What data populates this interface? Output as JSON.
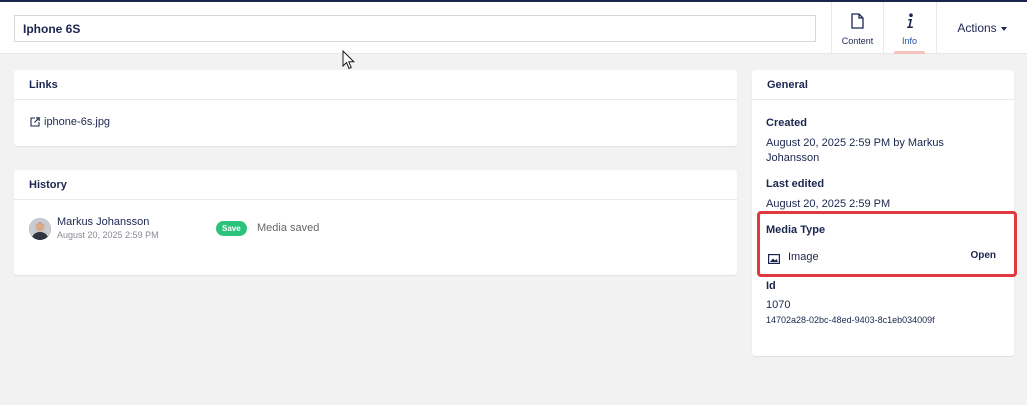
{
  "header": {
    "name_value": "Iphone 6S",
    "apps": [
      {
        "label": "Content",
        "icon": "document-icon"
      },
      {
        "label": "Info",
        "icon": "info-icon"
      }
    ],
    "actions_label": "Actions"
  },
  "links": {
    "title": "Links",
    "items": [
      {
        "label": "iphone-6s.jpg",
        "icon": "external-link-icon"
      }
    ]
  },
  "history": {
    "title": "History",
    "entries": [
      {
        "user": "Markus Johansson",
        "date": "August 20, 2025 2:59 PM",
        "badge": "Save",
        "message": "Media saved"
      }
    ]
  },
  "general": {
    "title": "General",
    "created_label": "Created",
    "created_value": "August 20, 2025 2:59 PM by Markus Johansson",
    "last_edited_label": "Last edited",
    "last_edited_value": "August 20, 2025 2:59 PM",
    "media_type_label": "Media Type",
    "media_type_value": "Image",
    "media_type_open": "Open",
    "id_label": "Id",
    "id_value": "1070",
    "key_value": "14702a28-02bc-48ed-9403-8c1eb034009f"
  },
  "colors": {
    "primary_text": "#1b264f",
    "badge_green": "#2bc37c",
    "active_tab_underline": "#f5c1bc",
    "highlight_border": "#e0383e",
    "background": "#f3f2f3"
  }
}
